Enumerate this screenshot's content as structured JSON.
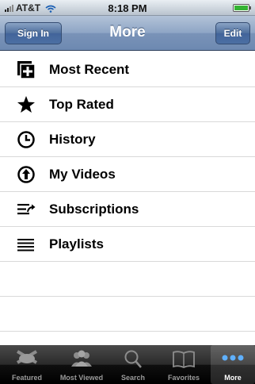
{
  "status_bar": {
    "carrier": "AT&T",
    "time": "8:18 PM"
  },
  "nav_bar": {
    "title": "More",
    "left_button": "Sign In",
    "right_button": "Edit"
  },
  "list": {
    "items": [
      {
        "label": "Most Recent",
        "icon": "most-recent-icon"
      },
      {
        "label": "Top Rated",
        "icon": "star-icon"
      },
      {
        "label": "History",
        "icon": "clock-icon"
      },
      {
        "label": "My Videos",
        "icon": "upload-arrow-icon"
      },
      {
        "label": "Subscriptions",
        "icon": "subscriptions-icon"
      },
      {
        "label": "Playlists",
        "icon": "playlist-icon"
      }
    ]
  },
  "tab_bar": {
    "tabs": [
      {
        "label": "Featured",
        "icon": "featured-icon"
      },
      {
        "label": "Most Viewed",
        "icon": "most-viewed-icon"
      },
      {
        "label": "Search",
        "icon": "search-icon"
      },
      {
        "label": "Favorites",
        "icon": "book-icon"
      },
      {
        "label": "More",
        "icon": "more-dots-icon",
        "active": true
      }
    ]
  },
  "colors": {
    "nav_blue": "#6d89b1",
    "battery": "#34b334",
    "tab_active_label": "#ffffff"
  }
}
